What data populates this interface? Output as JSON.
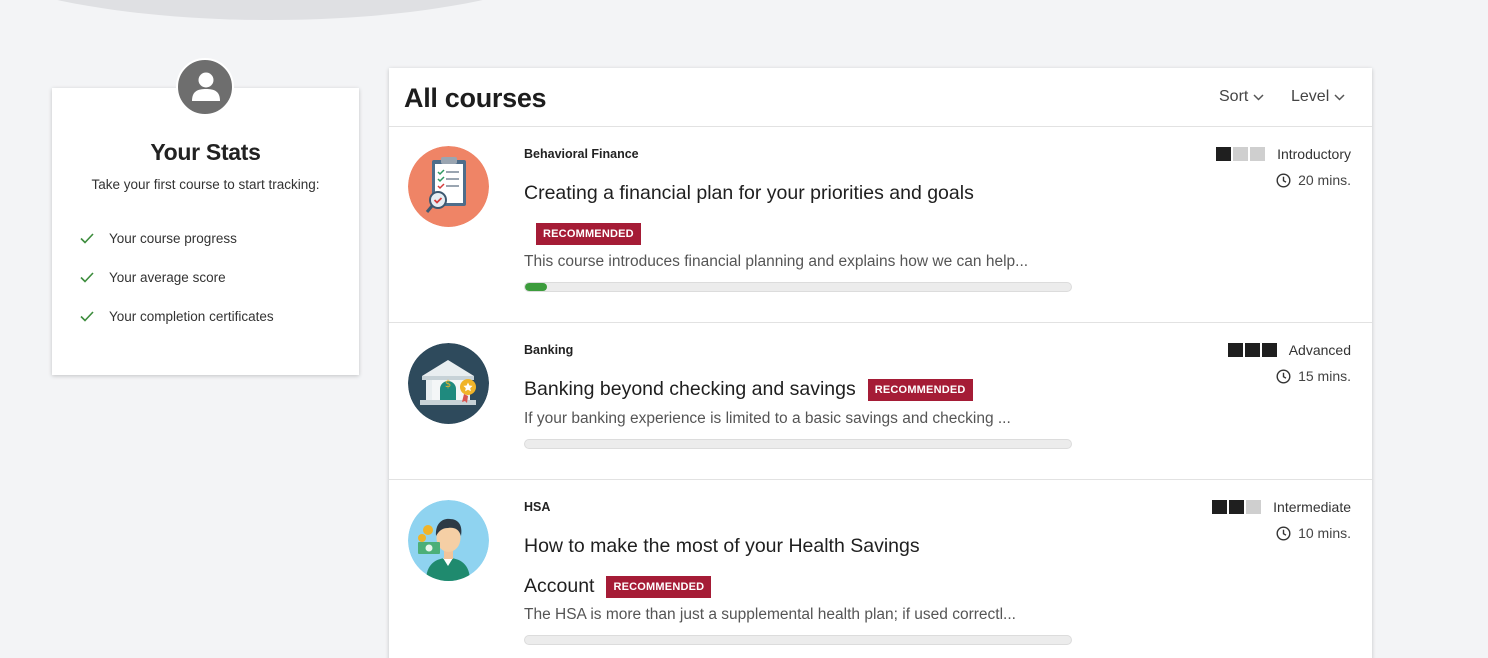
{
  "stats": {
    "title": "Your Stats",
    "subtitle": "Take your first course to start tracking:",
    "items": [
      "Your course progress",
      "Your average score",
      "Your completion certificates"
    ],
    "check_color": "#3c8c3c",
    "avatar_icon": "user-icon"
  },
  "courses": {
    "title": "All courses",
    "sort_label": "Sort",
    "level_label": "Level",
    "items": [
      {
        "category": "Behavioral Finance",
        "title": "Creating a financial plan for your priorities and goals",
        "badge": "RECOMMENDED",
        "description": "This course introduces financial planning and explains how we can help...",
        "progress": 0.04,
        "level": "Introductory",
        "level_bars": 1,
        "duration": "20 mins.",
        "icon": "financial-plan-clipboard-icon"
      },
      {
        "category": "Banking",
        "title": "Banking beyond checking and savings",
        "badge": "RECOMMENDED",
        "description": "If your banking experience is limited to a basic savings and checking ...",
        "progress": 0,
        "level": "Advanced",
        "level_bars": 3,
        "duration": "15 mins.",
        "icon": "bank-building-icon"
      },
      {
        "category": "HSA",
        "title": "How to make the most of your Health Savings Account",
        "badge": "RECOMMENDED",
        "description": "The HSA is more than just a supplemental health plan; if used correctl...",
        "progress": 0,
        "level": "Intermediate",
        "level_bars": 2,
        "duration": "10 mins.",
        "icon": "health-savings-person-icon"
      }
    ]
  },
  "colors": {
    "badge": "#a51c36",
    "progress_fill": "#3c9c3c",
    "level_on": "#1f1f1f",
    "level_off": "#cfcfcf"
  }
}
